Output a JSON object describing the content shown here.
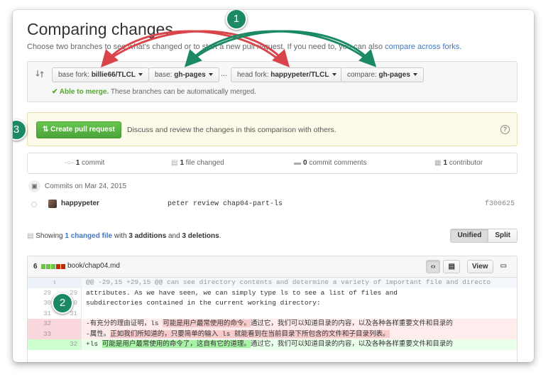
{
  "page": {
    "title": "Comparing changes",
    "subtitle": "Choose two branches to see what's changed or to start a new pull request. If you need to, you can also ",
    "subtitle_link": "compare across forks",
    "subtitle_end": "."
  },
  "range": {
    "base_fork_label": "base fork:",
    "base_fork_value": "billie66/TLCL",
    "base_label": "base:",
    "base_value": "gh-pages",
    "ellipsis": "...",
    "head_fork_label": "head fork:",
    "head_fork_value": "happypeter/TLCL",
    "compare_label": "compare:",
    "compare_value": "gh-pages",
    "merge_ok_label": "✔ Able to merge.",
    "merge_ok_text": " These branches can be automatically merged."
  },
  "pull_request": {
    "button_label": "Create pull request",
    "text": "Discuss and review the changes in this comparison with others."
  },
  "stats": {
    "commits_count": "1",
    "commits_label": "commit",
    "files_count": "1",
    "files_label": "file changed",
    "comments_count": "0",
    "comments_label": "commit comments",
    "contributors_count": "1",
    "contributors_label": "contributor"
  },
  "commits": {
    "date_header": "Commits on Mar 24, 2015",
    "rows": [
      {
        "author": "happypeter",
        "message": "peter review chap04-part-ls",
        "sha": "f300625"
      }
    ]
  },
  "summary": {
    "prefix": "Showing ",
    "link": "1 changed file",
    "mid": " with ",
    "additions": "3 additions",
    "and": " and ",
    "deletions": "3 deletions",
    "end": "."
  },
  "view_toggle": {
    "unified": "Unified",
    "split": "Split"
  },
  "file": {
    "change_count": "6",
    "path": "book/chap04.md",
    "view_label": "View",
    "diff_lines": [
      {
        "type": "hunk",
        "n1": "",
        "n2": "",
        "code": "@@ -29,15 +29,15 @@ can see directory contents and determine a variety of important file and directo"
      },
      {
        "type": "ctx",
        "n1": "29",
        "n2": "29",
        "code": " attributes. As we have seen, we can simply type ls to see a list of files and"
      },
      {
        "type": "ctx",
        "n1": "30",
        "n2": "30",
        "code": " subdirectories contained in the current working directory:"
      },
      {
        "type": "ctx",
        "n1": "31",
        "n2": "31",
        "code": ""
      },
      {
        "type": "del",
        "n1": "32",
        "n2": "",
        "code_pre": "-有充分的理由证明，ls ",
        "code_hl": "可能是用户最常使用的命令。",
        "code_post": "通过它，我们可以知道目录的内容，以及各种各样重要文件和目录的"
      },
      {
        "type": "del",
        "n1": "33",
        "n2": "",
        "code_pre": "-属性。",
        "code_hl": "正如我们所知道的，只要简单的输入 ls 就能看到在当前目录下所包含的文件和子目录列表。",
        "code_post": ""
      },
      {
        "type": "add",
        "n1": "",
        "n2": "32",
        "code_pre": "+ls ",
        "code_hl": "可能是用户最常使用的命令了，这自有它的道理。",
        "code_post": "通过它，我们可以知道目录的内容，以及各种各样重要文件和目录的"
      }
    ]
  },
  "badges": [
    "1",
    "2",
    "3"
  ],
  "colors": {
    "badge": "#1b8a64",
    "arrow_red": "#d9454a",
    "arrow_green": "#1b8a64",
    "link": "#4078c0",
    "merge_ok": "#55a532",
    "primary_button": "#55b340"
  },
  "icons": {
    "compare": "compare-icon",
    "pr": "git-pull-request-icon",
    "help": "question-icon",
    "commit": "git-commit-icon",
    "file": "file-diff-icon",
    "comment": "comment-icon",
    "contributor": "organization-icon",
    "calendar": "repo-push-icon",
    "expand": "unfold-icon",
    "code": "code-icon",
    "rich": "file-text-icon",
    "desktop": "desktop-icon"
  }
}
